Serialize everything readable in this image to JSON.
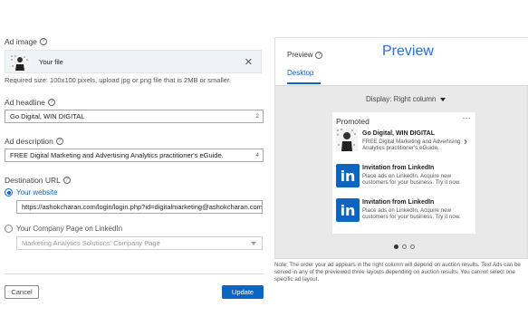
{
  "ad_image": {
    "label": "Ad image",
    "file_name": "Your file",
    "hint": "Required size: 100x100 pixels, upload jpg or png file that is 2MB or smaller."
  },
  "headline": {
    "label": "Ad headline",
    "value": "Go Digital, WIN DIGITAL",
    "counter": "2"
  },
  "description": {
    "label": "Ad description",
    "value": "FREE Digital Marketing and Advertising Analytics practitioner's eGuide.",
    "counter": "4"
  },
  "destination": {
    "label": "Destination URL",
    "option_website": "Your website",
    "url_value": "https://ashokcharan.com/login/login.php?id=digitalmarketing@ashokcharan.com",
    "option_company": "Your Company Page on LinkedIn",
    "company_placeholder": "Marketing Analytics Solutions' Company Page"
  },
  "buttons": {
    "cancel": "Cancel",
    "update": "Update"
  },
  "preview": {
    "label": "Preview",
    "heading": "Preview",
    "tab_desktop": "Desktop",
    "display": "Display: Right column",
    "promoted": "Promoted",
    "more": "···",
    "ads": [
      {
        "title": "Go Digital, WIN DIGITAL",
        "text": "FREE Digital Marketing and Advertising Analytics practitioner's eGuide."
      },
      {
        "title": "Invitation from LinkedIn",
        "text": "Place ads on LinkedIn. Acquire new customers for your business. Try it now."
      },
      {
        "title": "Invitation from LinkedIn",
        "text": "Place ads on LinkedIn. Acquire new customers for your business. Try it now."
      }
    ],
    "logo_text": "in",
    "note": "Note: The order your ad appears in the right column will depend on auction results. Text Ads can be served in any of the previewed three layouts depending on auction results. You cannot select one specific ad layout."
  },
  "colors": {
    "accent": "#0a66c2",
    "preview_heading": "#2a6fd1",
    "panel_bg": "#e9e9e9"
  }
}
